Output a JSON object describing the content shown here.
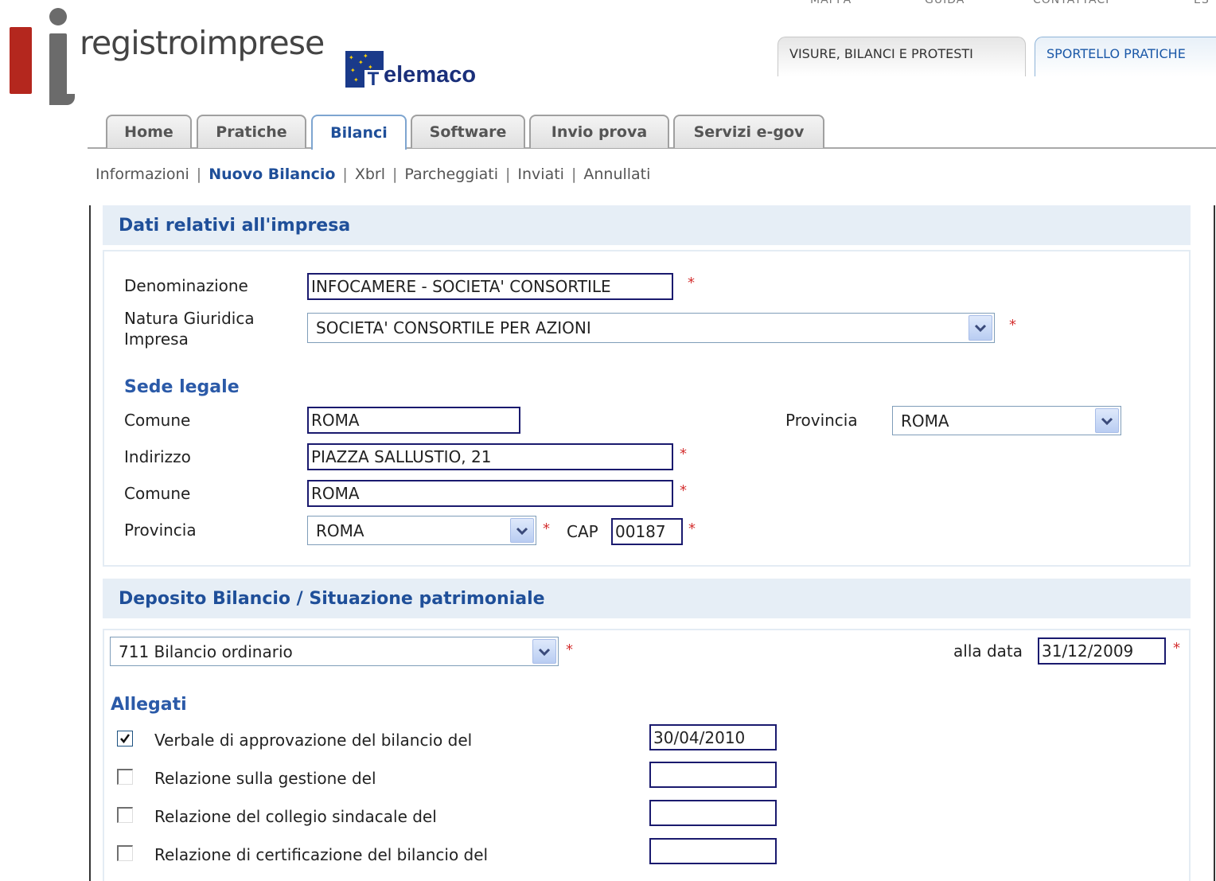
{
  "brand": {
    "name": "registroimprese",
    "product_rest": "elemaco",
    "product_initial": "T"
  },
  "top_links": [
    "MAPPA",
    "GUIDA",
    "CONTATTACI",
    "ES"
  ],
  "service_tabs": [
    "VISURE, BILANCI E PROTESTI",
    "SPORTELLO PRATICHE"
  ],
  "main_tabs": [
    "Home",
    "Pratiche",
    "Bilanci",
    "Software",
    "Invio prova",
    "Servizi e-gov"
  ],
  "sub_nav": [
    "Informazioni",
    "Nuovo Bilancio",
    "Xbrl",
    "Parcheggiati",
    "Inviati",
    "Annullati"
  ],
  "impresa": {
    "title": "Dati relativi all'impresa",
    "denominazione_label": "Denominazione",
    "denominazione_value": "INFOCAMERE - SOCIETA' CONSORTILE",
    "natura_label_1": "Natura Giuridica",
    "natura_label_2": "Impresa",
    "natura_value": "SOCIETA' CONSORTILE PER AZIONI",
    "sede_title": "Sede legale",
    "comune_label": "Comune",
    "comune_value": "ROMA",
    "provincia_label": "Provincia",
    "provincia_value": "ROMA",
    "indirizzo_label": "Indirizzo",
    "indirizzo_value": "PIAZZA SALLUSTIO, 21",
    "comune2_label": "Comune",
    "comune2_value": "ROMA",
    "provincia2_label": "Provincia",
    "provincia2_value": "ROMA",
    "cap_label": "CAP",
    "cap_value": "00187"
  },
  "deposito": {
    "title": "Deposito Bilancio / Situazione patrimoniale",
    "tipo_value": "711 Bilancio ordinario",
    "data_label": "alla data",
    "data_value": "31/12/2009",
    "allegati_title": "Allegati",
    "allegati": [
      {
        "label": "Verbale di approvazione del bilancio del",
        "checked": true,
        "date": "30/04/2010"
      },
      {
        "label": "Relazione sulla gestione del",
        "checked": false,
        "date": ""
      },
      {
        "label": "Relazione del collegio sindacale del",
        "checked": false,
        "date": ""
      },
      {
        "label": "Relazione di certificazione del bilancio del",
        "checked": false,
        "date": ""
      }
    ]
  },
  "required_mark": "*",
  "colors": {
    "accent": "#1f4f99",
    "section_bg": "#e6eef6",
    "required": "#d43030",
    "logo_red": "#b4271e",
    "logo_grey": "#6b6b6b"
  }
}
